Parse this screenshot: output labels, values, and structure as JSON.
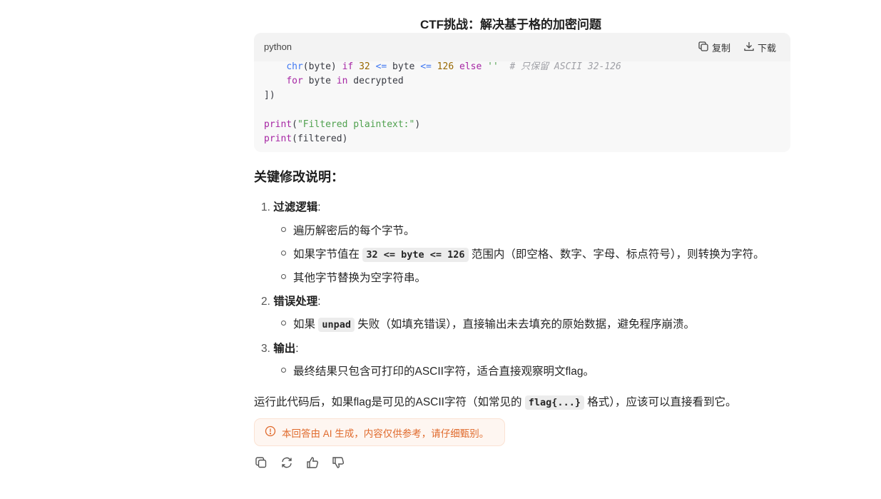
{
  "title": "CTF挑战：解决基于格的加密问题",
  "code_block": {
    "language": "python",
    "copy_label": "复制",
    "download_label": "下载"
  },
  "heading": "关键修改说明：",
  "list": [
    {
      "num": "1.",
      "title": "过滤逻辑",
      "colon": ":",
      "bullets": [
        {
          "pre": "遍历解密后的每个字节。"
        },
        {
          "pre": "如果字节值在",
          "code": "32 <= byte <= 126",
          "post": "范围内（即空格、数字、字母、标点符号），则转换为字符。"
        },
        {
          "pre": "其他字节替换为空字符串。"
        }
      ]
    },
    {
      "num": "2.",
      "title": "错误处理",
      "colon": ":",
      "bullets": [
        {
          "pre": "如果",
          "code": "unpad",
          "post": "失败（如填充错误），直接输出未去填充的原始数据，避免程序崩溃。"
        }
      ]
    },
    {
      "num": "3.",
      "title": "输出",
      "colon": ":",
      "bullets": [
        {
          "pre": "最终结果只包含可打印的ASCII字符，适合直接观察明文flag。"
        }
      ]
    }
  ],
  "summary": {
    "pre": "运行此代码后，如果flag是可见的ASCII字符（如常见的",
    "code": "flag{...}",
    "post": "格式），应该可以直接看到它。"
  },
  "notice": "本回答由 AI 生成，内容仅供参考，请仔细甄别。",
  "icons": {
    "copy": "copy-icon",
    "download": "download-icon",
    "info": "info-icon",
    "regenerate": "refresh-icon",
    "like": "thumbs-up-icon",
    "dislike": "thumbs-down-icon"
  },
  "colors": {
    "notice_text": "#e06a2c",
    "code_bg": "#f8f8f8",
    "keyword": "#a626a4",
    "string": "#50a14f",
    "number": "#986801"
  }
}
